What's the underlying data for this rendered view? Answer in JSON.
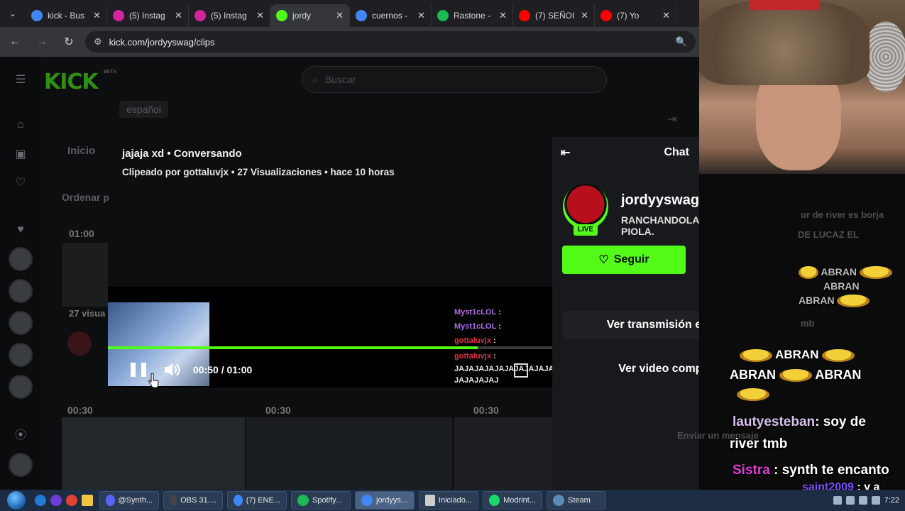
{
  "browser": {
    "tabs": [
      {
        "label": "kick - Bus",
        "favicon": "google-icon",
        "color": "#4285f4"
      },
      {
        "label": "(5) Instag",
        "favicon": "instagram-icon",
        "color": "#d6249f"
      },
      {
        "label": "(5) Instag",
        "favicon": "instagram-icon",
        "color": "#d6249f"
      },
      {
        "label": "jordy",
        "favicon": "kick-icon",
        "color": "#53fc18",
        "active": true
      },
      {
        "label": "cuernos -",
        "favicon": "google-icon",
        "color": "#4285f4"
      },
      {
        "label": "Rastone -",
        "favicon": "spotify-icon",
        "color": "#1db954"
      },
      {
        "label": "(7) SEÑOI",
        "favicon": "youtube-icon",
        "color": "#ff0000"
      },
      {
        "label": "(7) Yo",
        "favicon": "youtube-icon",
        "color": "#ff0000"
      }
    ],
    "url": "kick.com/jordyyswag/clips"
  },
  "kick": {
    "logo": "KICK",
    "beta": "BETA",
    "search_placeholder": "Buscar",
    "language_chip": "español",
    "inicio": "Inicio",
    "ordenar": "Ordenar p",
    "bg_times": [
      "01:00",
      "00:30",
      "00:30",
      "00:30"
    ],
    "bg_views": "27 visua"
  },
  "clip": {
    "title": "jajaja xd • Conversando",
    "meta": "Clipeado por gottaluvjx • 27 Visualizaciones • hace 10 horas",
    "time": "00:50 / 01:00",
    "progress": 0.833
  },
  "clip_chat": [
    {
      "user": "Myst1cLOL",
      "text": ":",
      "color": "#b06be8"
    },
    {
      "user": "Myst1cLOL",
      "text": ":",
      "color": "#b06be8"
    },
    {
      "user": "gottaluvjx",
      "text": ":",
      "color": "#e0304a"
    },
    {
      "user": "gottaluvjx",
      "text": ":",
      "color": "#e0304a"
    },
    {
      "user": "",
      "text": "JAJAJAJAJAJAJAJAJAJA",
      "color": "#ffffff"
    },
    {
      "user": "",
      "text": "JAJAJAJAJ",
      "color": "#ffffff"
    }
  ],
  "side": {
    "chat_title": "Chat",
    "channel": "jordyyswag",
    "subtitle": "RANCHANDOLA PIOLA.",
    "live": "LIVE",
    "follow": "Seguir",
    "watch_live": "Ver transmisión en vivo",
    "watch_full": "Ver video completo"
  },
  "stream_chat": {
    "dim_lines": [
      "ur de river es borja",
      "DE LUCAZ EL",
      "mb",
      "Enviar un mensaje"
    ],
    "abran_lines": [
      "ABRAN",
      "ABRAN",
      "ABRAN",
      "ABRAN",
      "ABRAN",
      "ABRAN"
    ],
    "messages": [
      {
        "user": "lautyesteban",
        "text": ": soy de",
        "text2": "river tmb",
        "color": "#d9c2f0"
      },
      {
        "user": "Sistra",
        "text": ": synth te encanto",
        "color": "#e03bd2"
      },
      {
        "user": "saint2009",
        "text": ": y a",
        "color": "#7c4dff"
      }
    ]
  },
  "taskbar": {
    "items": [
      {
        "label": "@Synth...",
        "color": "#5865f2"
      },
      {
        "label": "OBS 31....",
        "color": "#302e31"
      },
      {
        "label": "(7) ENE...",
        "color": "#4285f4"
      },
      {
        "label": "Spotify...",
        "color": "#1db954"
      },
      {
        "label": "jordyys...",
        "color": "#4285f4",
        "active": true
      },
      {
        "label": "Iniciado...",
        "color": "#cccccc"
      },
      {
        "label": "Modrint...",
        "color": "#1bd96a"
      },
      {
        "label": "Steam",
        "color": "#1b2838"
      }
    ],
    "clock": "7:22"
  }
}
